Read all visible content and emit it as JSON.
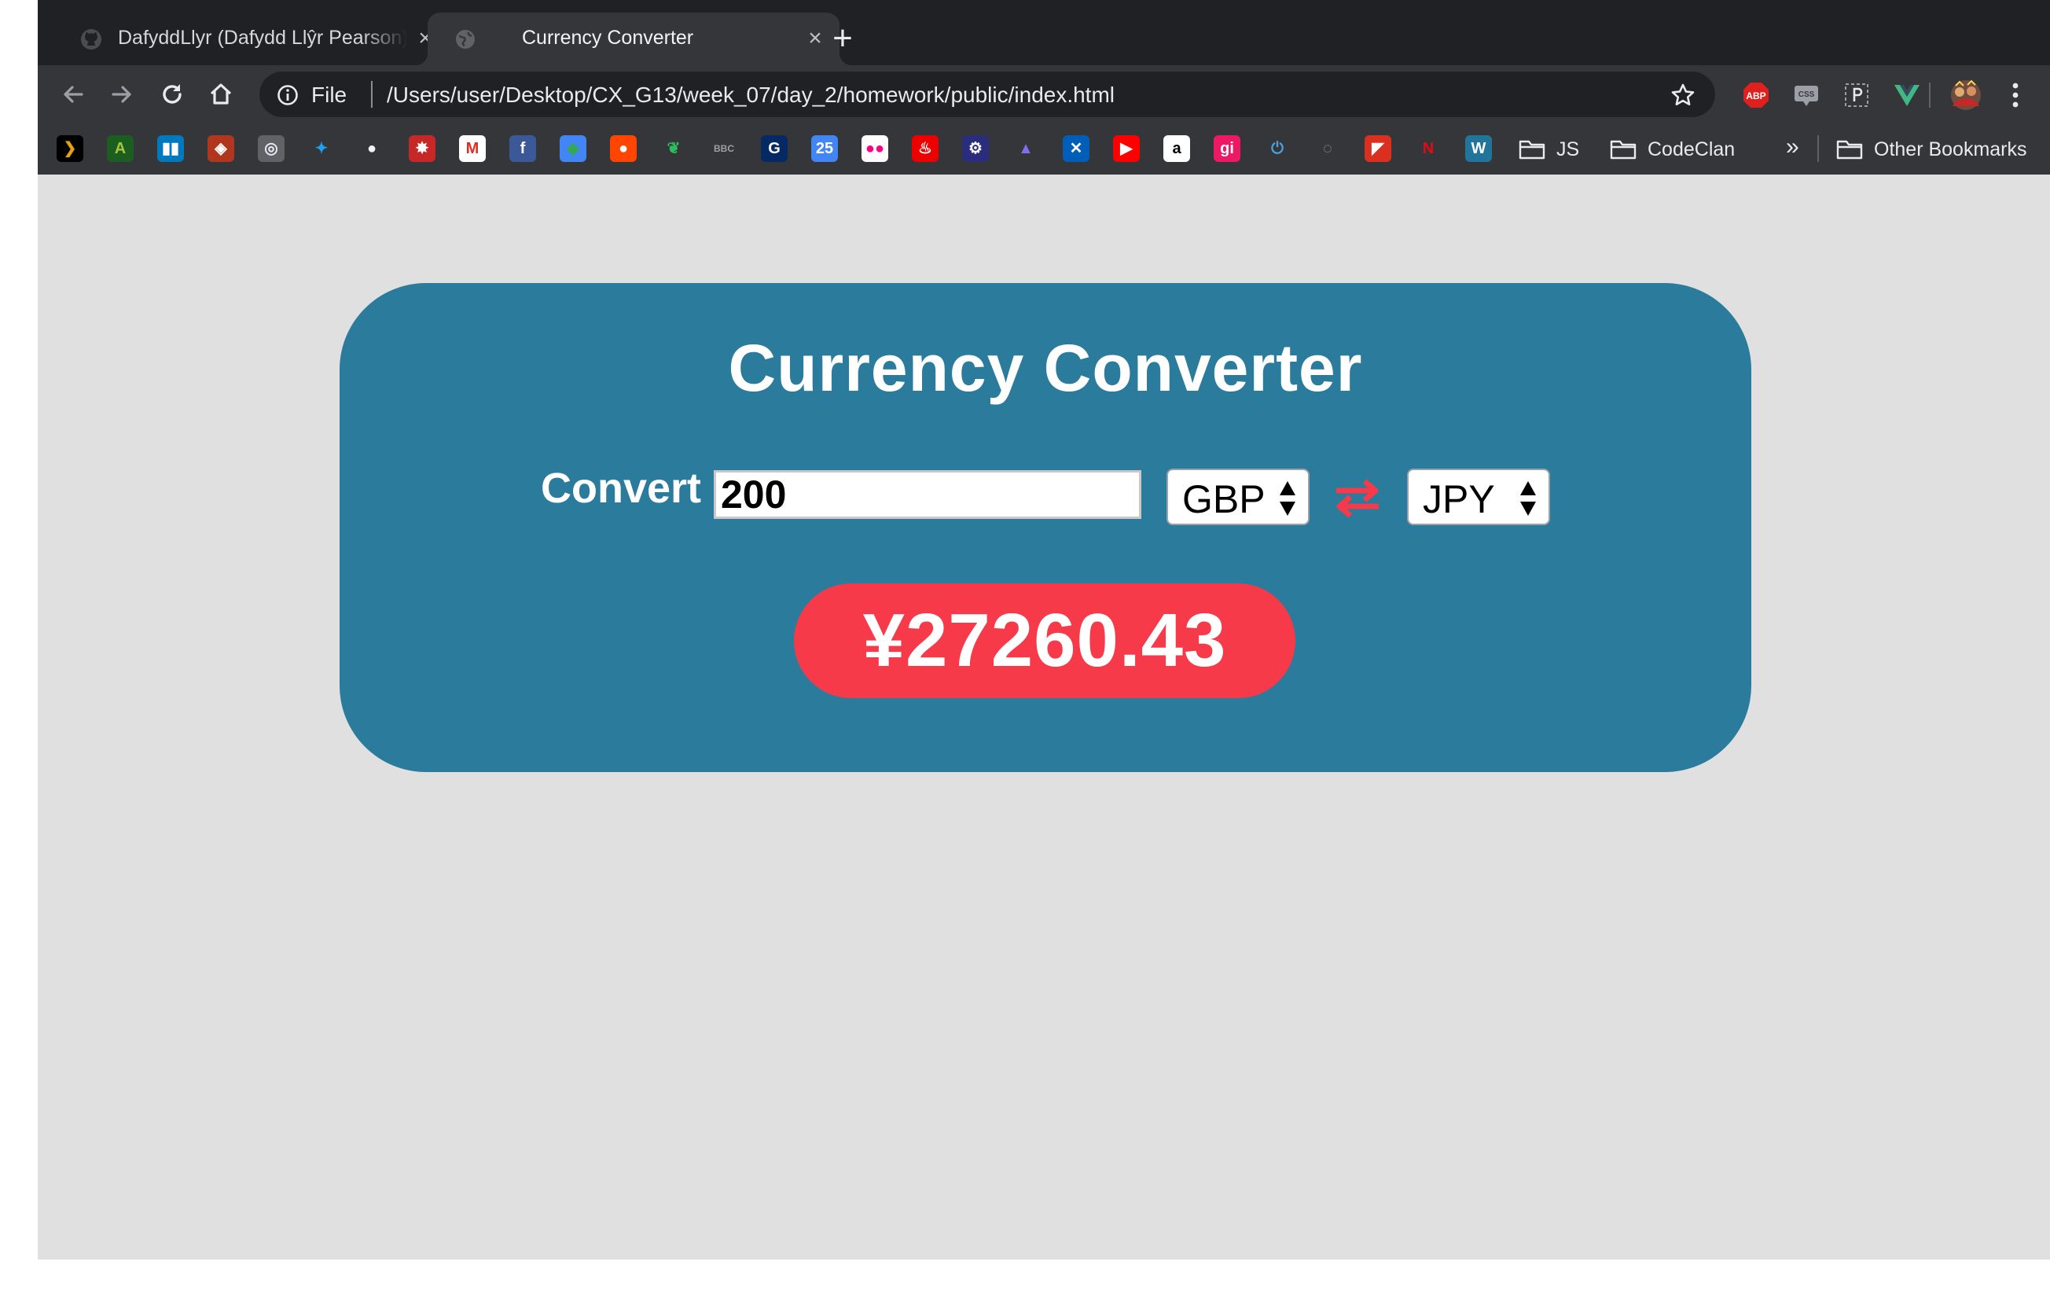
{
  "browser": {
    "tabs": [
      {
        "title": "DafyddLlyr (Dafydd Llŷr Pearson)",
        "favicon": "github-icon",
        "active": false
      },
      {
        "title": "Currency Converter",
        "favicon": "globe-icon",
        "active": true
      }
    ],
    "address": {
      "scheme": "File",
      "url": "/Users/user/Desktop/CX_G13/week_07/day_2/homework/public/index.html"
    },
    "extensions": {
      "adblock": "ABP",
      "css_viewer": "CSS"
    },
    "bookmarks": {
      "icons": [
        {
          "name": "plex-icon",
          "glyph": "❯",
          "color": "#e5a00d",
          "bg": "#000000"
        },
        {
          "name": "android-studio-icon",
          "glyph": "A",
          "color": "#a4c639",
          "bg": "#1b5e20"
        },
        {
          "name": "trello-icon",
          "glyph": "▮▮",
          "color": "#ffffff",
          "bg": "#0079bf"
        },
        {
          "name": "codewars-icon",
          "glyph": "◈",
          "color": "#ffffff",
          "bg": "#b1361e"
        },
        {
          "name": "swirl-icon",
          "glyph": "◎",
          "color": "#e8eaed",
          "bg": "#5f6368"
        },
        {
          "name": "twitter-icon",
          "glyph": "✦",
          "color": "#1da1f2",
          "bg": "transparent"
        },
        {
          "name": "github-icon",
          "glyph": "●",
          "color": "#f1f3f4",
          "bg": "transparent"
        },
        {
          "name": "runner-icon",
          "glyph": "✸",
          "color": "#ffffff",
          "bg": "#c62828"
        },
        {
          "name": "gmail-icon",
          "glyph": "M",
          "color": "#d93025",
          "bg": "#ffffff"
        },
        {
          "name": "facebook-icon",
          "glyph": "f",
          "color": "#ffffff",
          "bg": "#3b5998"
        },
        {
          "name": "google-maps-icon",
          "glyph": "◆",
          "color": "#34a853",
          "bg": "#4285f4"
        },
        {
          "name": "reddit-icon",
          "glyph": "●",
          "color": "#ffffff",
          "bg": "#ff4500"
        },
        {
          "name": "evernote-icon",
          "glyph": "❦",
          "color": "#2dbe60",
          "bg": "transparent"
        },
        {
          "name": "bbc-icon",
          "glyph": "BBC",
          "color": "#9aa0a6",
          "bg": "transparent"
        },
        {
          "name": "guardian-icon",
          "glyph": "G",
          "color": "#ffffff",
          "bg": "#052962"
        },
        {
          "name": "calendar-icon",
          "glyph": "25",
          "color": "#ffffff",
          "bg": "#4285f4"
        },
        {
          "name": "flickr-icon",
          "glyph": "●●",
          "color": "#ff0084",
          "bg": "#ffffff"
        },
        {
          "name": "santander-icon",
          "glyph": "♨",
          "color": "#ffffff",
          "bg": "#ec0000"
        },
        {
          "name": "cycling-icon",
          "glyph": "⚙",
          "color": "#ffffff",
          "bg": "#2a2d7c"
        },
        {
          "name": "jira-icon",
          "glyph": "▲",
          "color": "#7f6df2",
          "bg": "transparent"
        },
        {
          "name": "halifax-icon",
          "glyph": "✕",
          "color": "#ffffff",
          "bg": "#005eb8"
        },
        {
          "name": "youtube-icon",
          "glyph": "▶",
          "color": "#ffffff",
          "bg": "#ff0000"
        },
        {
          "name": "amazon-icon",
          "glyph": "a",
          "color": "#000000",
          "bg": "#ffffff"
        },
        {
          "name": "gitter-icon",
          "glyph": "gi",
          "color": "#ffffff",
          "bg": "#ed1965"
        },
        {
          "name": "power-icon",
          "glyph": "⏻",
          "color": "#4aa3df",
          "bg": "transparent"
        },
        {
          "name": "loader-icon",
          "glyph": "◌",
          "color": "#9aa0a6",
          "bg": "transparent"
        },
        {
          "name": "speakerdeck-icon",
          "glyph": "◤",
          "color": "#ffffff",
          "bg": "#d9301f"
        },
        {
          "name": "netflix-icon",
          "glyph": "N",
          "color": "#e50914",
          "bg": "transparent"
        },
        {
          "name": "wordpress-icon",
          "glyph": "W",
          "color": "#ffffff",
          "bg": "#21759b"
        }
      ],
      "folders": [
        "JS",
        "CodeClan"
      ],
      "overflow": "»",
      "other": "Other Bookmarks"
    }
  },
  "converter": {
    "heading": "Currency Converter",
    "convert_label": "Convert",
    "amount": "200",
    "from_currency": "GBP",
    "to_currency": "JPY",
    "result": "¥27260.43"
  },
  "colors": {
    "card": "#2b7b9c",
    "accent": "#f63a4a",
    "page_bg": "#e0e0e0"
  }
}
